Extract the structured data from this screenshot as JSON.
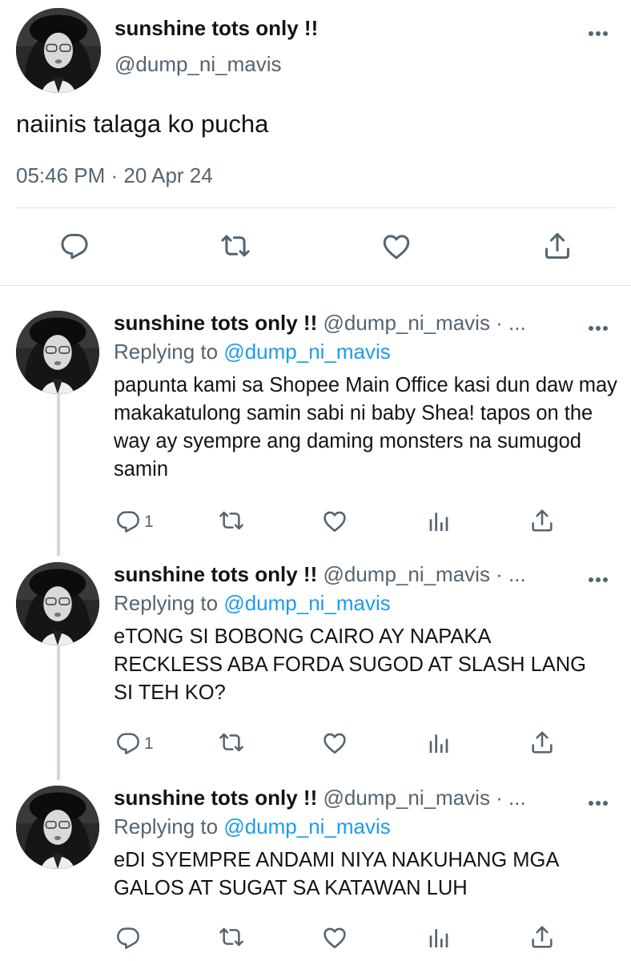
{
  "main_tweet": {
    "display_name": "sunshine tots only !!",
    "handle": "@dump_ni_mavis",
    "text": "naiinis talaga ko pucha",
    "timestamp": "05:46 PM · 20 Apr 24",
    "actions": [
      "reply-icon",
      "retweet-icon",
      "like-icon",
      "share-icon"
    ]
  },
  "replies": [
    {
      "display_name": "sunshine tots only !!",
      "handle": "@dump_ni_mavis · ...",
      "replying_prefix": "Replying to",
      "replying_to": "@dump_ni_mavis",
      "text": "papunta kami sa Shopee Main Office kasi dun daw may makakatulong samin sabi ni baby Shea! tapos on the way ay syempre ang daming monsters na sumugod samin",
      "reply_count": "1"
    },
    {
      "display_name": "sunshine tots only !!",
      "handle": "@dump_ni_mavis · ...",
      "replying_prefix": "Replying to",
      "replying_to": "@dump_ni_mavis",
      "text": "eTONG SI BOBONG CAIRO AY NAPAKA RECKLESS ABA FORDA SUGOD AT SLASH LANG SI TEH KO?",
      "reply_count": "1"
    },
    {
      "display_name": "sunshine tots only !!",
      "handle": "@dump_ni_mavis · ...",
      "replying_prefix": "Replying to",
      "replying_to": "@dump_ni_mavis",
      "text": "eDI SYEMPRE ANDAMI NIYA NAKUHANG MGA GALOS AT SUGAT SA KATAWAN LUH",
      "reply_count": ""
    }
  ],
  "colors": {
    "text": "#0f1419",
    "secondary": "#536471",
    "link": "#1d9bf0",
    "divider": "#dfe3e6",
    "thread_line": "#cfd9de"
  }
}
